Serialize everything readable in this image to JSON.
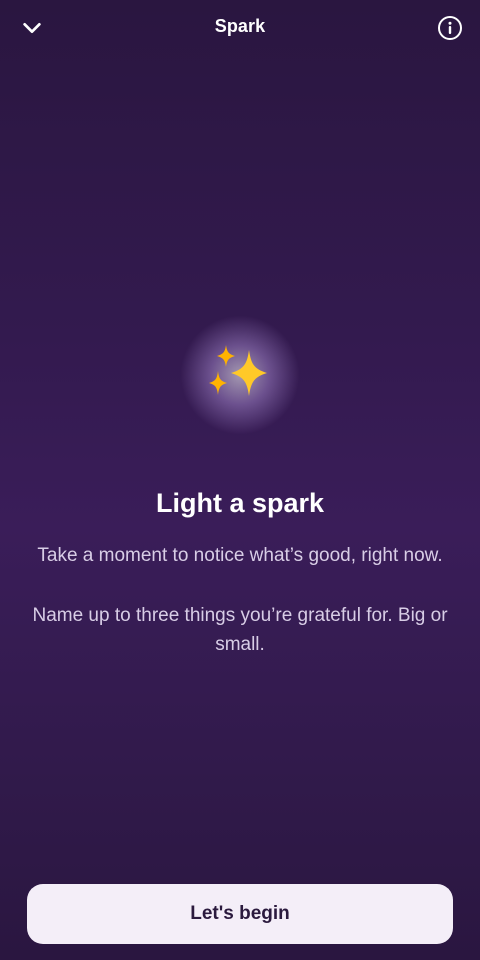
{
  "header": {
    "title": "Spark",
    "back_icon": "chevron-down-icon",
    "info_icon": "info-icon"
  },
  "hero": {
    "icon": "sparkles-icon",
    "heading": "Light a spark",
    "description_1": "Take a moment to notice what’s good, right now.",
    "description_2": "Name up to three things you’re grateful for. Big or small."
  },
  "cta": {
    "label": "Let's begin"
  },
  "colors": {
    "background_top": "#2a1640",
    "background_mid": "#3a1d59",
    "button_bg": "#f4eef8",
    "button_text": "#2b1a3e",
    "sparkle": "#ffc928"
  }
}
